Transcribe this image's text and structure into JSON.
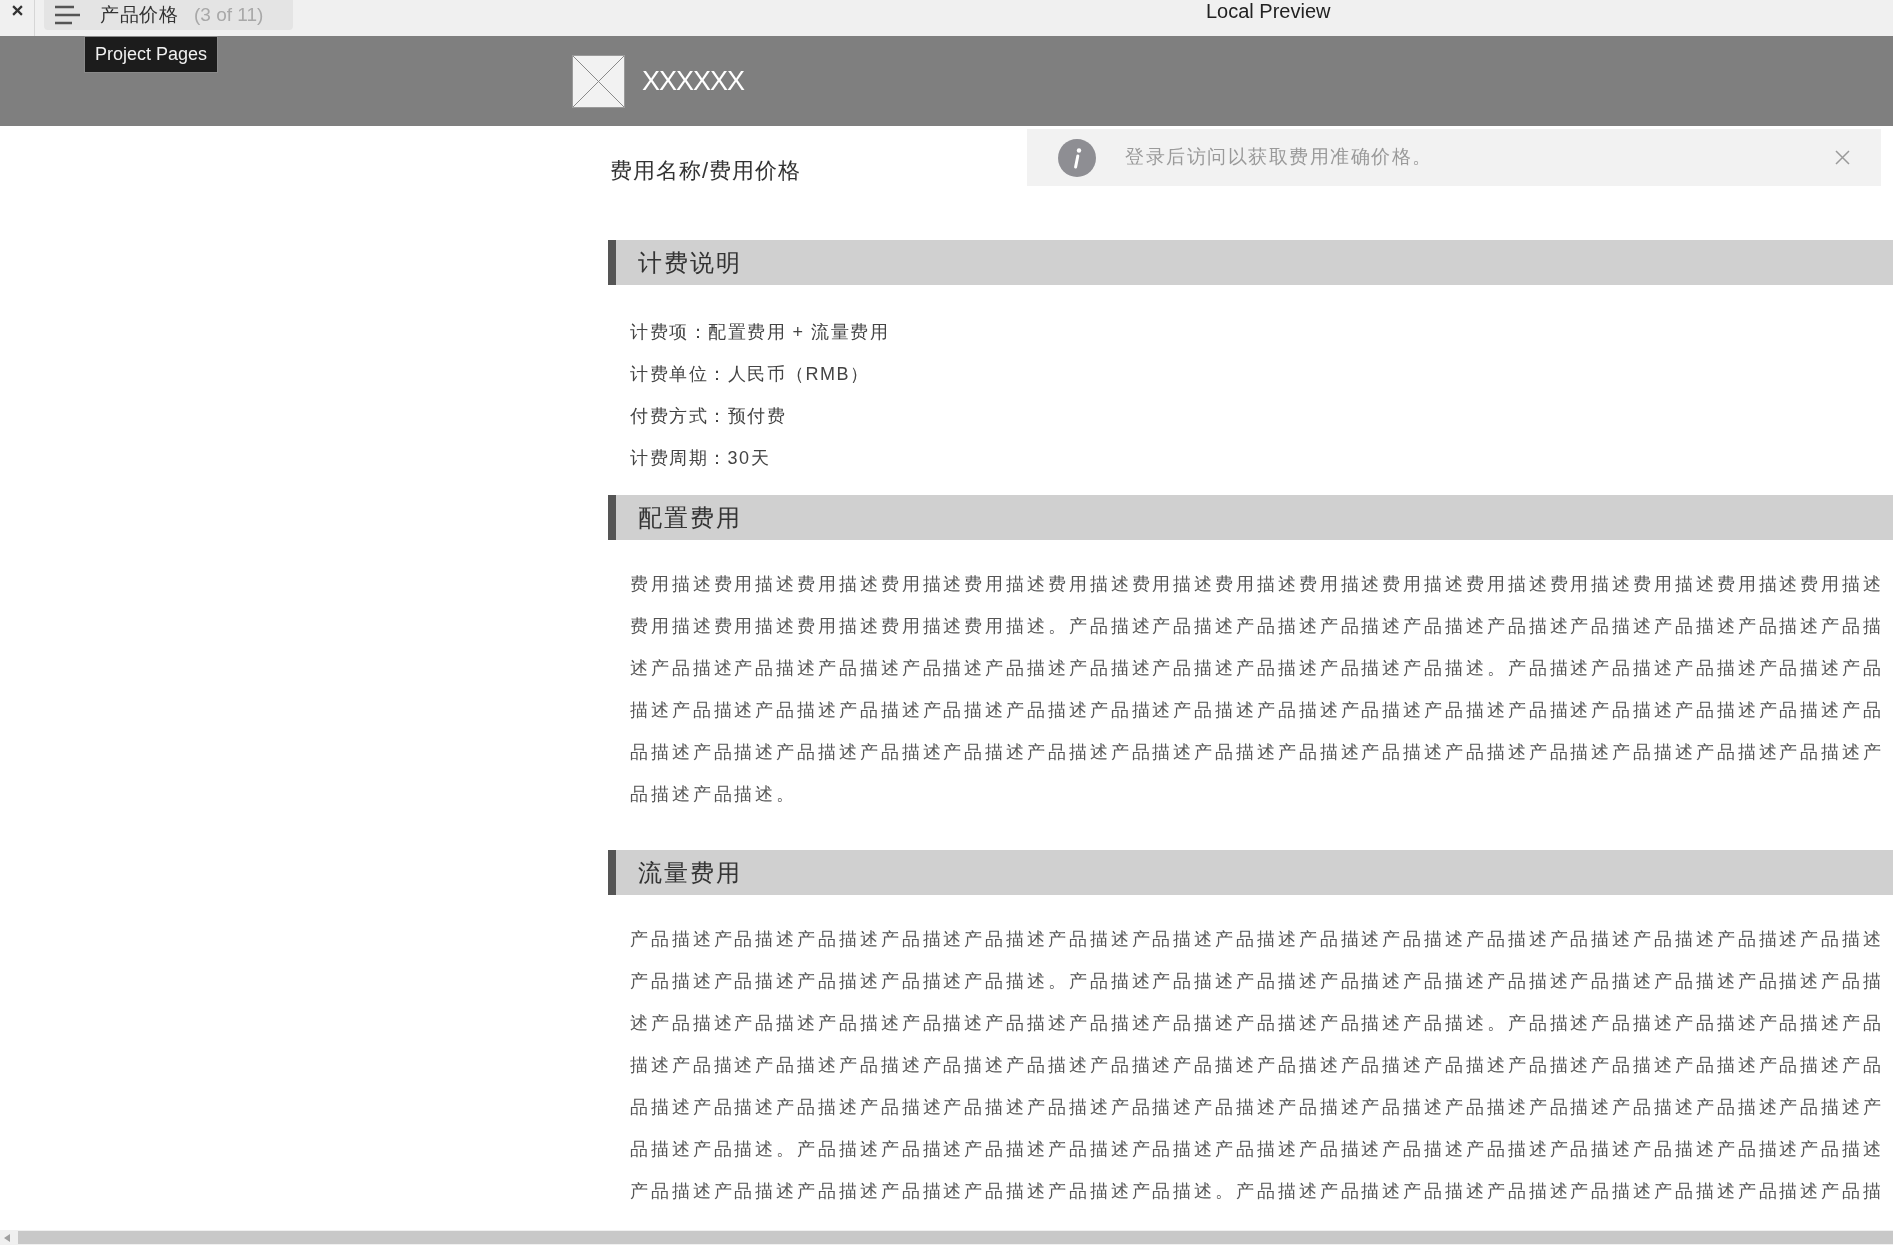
{
  "window": {
    "title": "Local Preview"
  },
  "page_tab": {
    "title": "产品价格",
    "position": "(3 of 11)"
  },
  "tooltip": "Project Pages",
  "header": {
    "brand": "XXXXXX"
  },
  "page_title": "费用名称/费用价格",
  "notice": {
    "text": "登录后访问以获取费用准确价格。"
  },
  "sections": [
    {
      "kind": "list",
      "title": "计费说明",
      "items": [
        "计费项：配置费用 + 流量费用",
        "计费单位：人民币（RMB）",
        "付费方式：预付费",
        "计费周期：30天"
      ]
    },
    {
      "kind": "text",
      "title": "配置费用",
      "lines": [
        "费用描述费用描述费用描述费用描述费用描述费用描述费用描述费用描述费用描述费用描述费用描述费用描述费用描述费用描述费用描述",
        "费用描述费用描述费用描述费用描述费用描述。产品描述产品描述产品描述产品描述产品描述产品描述产品描述产品描述产品描述产品描",
        "述产品描述产品描述产品描述产品描述产品描述产品描述产品描述产品描述产品描述产品描述。产品描述产品描述产品描述产品描述产品",
        "描述产品描述产品描述产品描述产品描述产品描述产品描述产品描述产品描述产品描述产品描述产品描述产品描述产品描述产品描述产品",
        "品描述产品描述产品描述产品描述产品描述产品描述产品描述产品描述产品描述产品描述产品描述产品描述产品描述产品描述产品描述产",
        "品描述产品描述。"
      ]
    },
    {
      "kind": "text",
      "title": "流量费用",
      "lines": [
        "产品描述产品描述产品描述产品描述产品描述产品描述产品描述产品描述产品描述产品描述产品描述产品描述产品描述产品描述产品描述",
        "产品描述产品描述产品描述产品描述产品描述。产品描述产品描述产品描述产品描述产品描述产品描述产品描述产品描述产品描述产品描",
        "述产品描述产品描述产品描述产品描述产品描述产品描述产品描述产品描述产品描述产品描述。产品描述产品描述产品描述产品描述产品",
        "描述产品描述产品描述产品描述产品描述产品描述产品描述产品描述产品描述产品描述产品描述产品描述产品描述产品描述产品描述产品",
        "品描述产品描述产品描述产品描述产品描述产品描述产品描述产品描述产品描述产品描述产品描述产品描述产品描述产品描述产品描述产",
        "品描述产品描述。产品描述产品描述产品描述产品描述产品描述产品描述产品描述产品描述产品描述产品描述产品描述产品描述产品描述",
        "产品描述产品描述产品描述产品描述产品描述产品描述产品描述。产品描述产品描述产品描述产品描述产品描述产品描述产品描述产品描"
      ]
    }
  ]
}
